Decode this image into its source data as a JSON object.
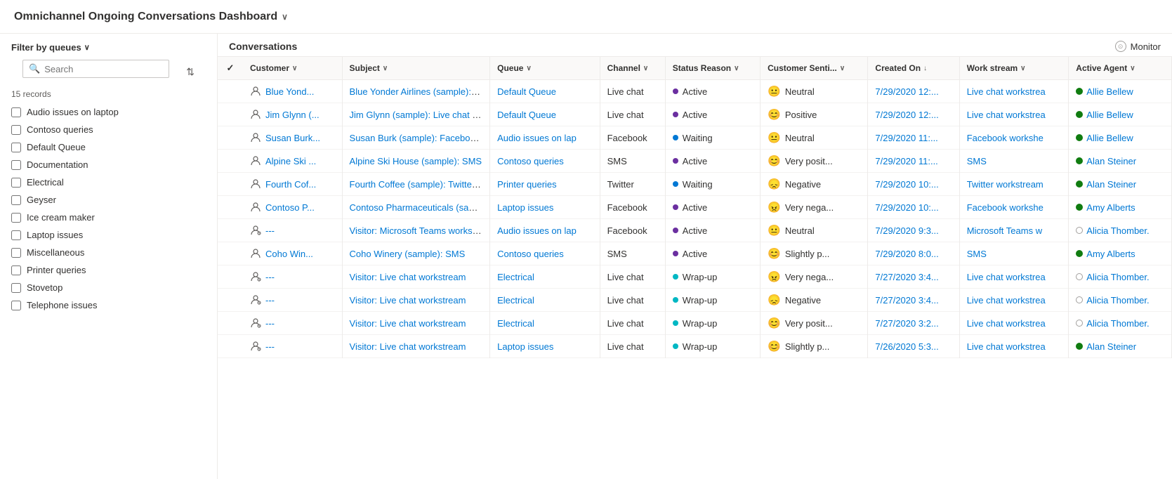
{
  "app": {
    "title": "Omnichannel Ongoing Conversations Dashboard",
    "title_chevron": "∨"
  },
  "sidebar": {
    "filter_label": "Filter by queues",
    "filter_chevron": "∨",
    "search_placeholder": "Search",
    "records_count": "15 records",
    "sort_icon": "⇅",
    "queues": [
      {
        "id": "audio-issues",
        "label": "Audio issues on laptop",
        "checked": false
      },
      {
        "id": "contoso-queries",
        "label": "Contoso queries",
        "checked": false
      },
      {
        "id": "default-queue",
        "label": "Default Queue",
        "checked": false
      },
      {
        "id": "documentation",
        "label": "Documentation",
        "checked": false
      },
      {
        "id": "electrical",
        "label": "Electrical",
        "checked": false
      },
      {
        "id": "geyser",
        "label": "Geyser",
        "checked": false
      },
      {
        "id": "ice-cream-maker",
        "label": "Ice cream maker",
        "checked": false
      },
      {
        "id": "laptop-issues",
        "label": "Laptop issues",
        "checked": false
      },
      {
        "id": "miscellaneous",
        "label": "Miscellaneous",
        "checked": false
      },
      {
        "id": "printer-queries",
        "label": "Printer queries",
        "checked": false
      },
      {
        "id": "stovetop",
        "label": "Stovetop",
        "checked": false
      },
      {
        "id": "telephone-issues",
        "label": "Telephone issues",
        "checked": false
      }
    ]
  },
  "content": {
    "title": "Conversations",
    "monitor_label": "Monitor"
  },
  "table": {
    "columns": [
      {
        "id": "check",
        "label": "✓",
        "sortable": false
      },
      {
        "id": "customer",
        "label": "Customer",
        "sortable": true
      },
      {
        "id": "subject",
        "label": "Subject",
        "sortable": true
      },
      {
        "id": "queue",
        "label": "Queue",
        "sortable": true
      },
      {
        "id": "channel",
        "label": "Channel",
        "sortable": true
      },
      {
        "id": "status_reason",
        "label": "Status Reason",
        "sortable": true
      },
      {
        "id": "customer_sentiment",
        "label": "Customer Senti...",
        "sortable": true
      },
      {
        "id": "created_on",
        "label": "Created On",
        "sortable": true,
        "active_sort": true
      },
      {
        "id": "work_stream",
        "label": "Work stream",
        "sortable": true
      },
      {
        "id": "active_agent",
        "label": "Active Agent",
        "sortable": true
      }
    ],
    "rows": [
      {
        "customer_icon": "person",
        "customer": "Blue Yond...",
        "subject": "Blue Yonder Airlines (sample): Live c",
        "queue": "Default Queue",
        "channel": "Live chat",
        "status_dot": "active",
        "status": "Active",
        "sentiment_emoji": "😐",
        "sentiment": "Neutral",
        "created_on": "7/29/2020 12:...",
        "workstream": "Live chat workstrea",
        "agent_dot": "green",
        "agent": "Allie Bellew"
      },
      {
        "customer_icon": "person",
        "customer": "Jim Glynn (...",
        "subject": "Jim Glynn (sample): Live chat works",
        "queue": "Default Queue",
        "channel": "Live chat",
        "status_dot": "active",
        "status": "Active",
        "sentiment_emoji": "😊",
        "sentiment": "Positive",
        "created_on": "7/29/2020 12:...",
        "workstream": "Live chat workstrea",
        "agent_dot": "green",
        "agent": "Allie Bellew"
      },
      {
        "customer_icon": "person",
        "customer": "Susan Burk...",
        "subject": "Susan Burk (sample): Facebook wor",
        "queue": "Audio issues on lap",
        "channel": "Facebook",
        "status_dot": "waiting",
        "status": "Waiting",
        "sentiment_emoji": "😐",
        "sentiment": "Neutral",
        "created_on": "7/29/2020 11:...",
        "workstream": "Facebook workshe",
        "agent_dot": "green",
        "agent": "Allie Bellew"
      },
      {
        "customer_icon": "person",
        "customer": "Alpine Ski ...",
        "subject": "Alpine Ski House (sample): SMS",
        "queue": "Contoso queries",
        "channel": "SMS",
        "status_dot": "active",
        "status": "Active",
        "sentiment_emoji": "😊",
        "sentiment": "Very posit...",
        "created_on": "7/29/2020 11:...",
        "workstream": "SMS",
        "agent_dot": "green",
        "agent": "Alan Steiner"
      },
      {
        "customer_icon": "person",
        "customer": "Fourth Cof...",
        "subject": "Fourth Coffee (sample): Twitter wor",
        "queue": "Printer queries",
        "channel": "Twitter",
        "status_dot": "waiting",
        "status": "Waiting",
        "sentiment_emoji": "😞",
        "sentiment": "Negative",
        "created_on": "7/29/2020 10:...",
        "workstream": "Twitter workstream",
        "agent_dot": "green",
        "agent": "Alan Steiner"
      },
      {
        "customer_icon": "person",
        "customer": "Contoso P...",
        "subject": "Contoso Pharmaceuticals (sample):",
        "queue": "Laptop issues",
        "channel": "Facebook",
        "status_dot": "active",
        "status": "Active",
        "sentiment_emoji": "😠",
        "sentiment": "Very nega...",
        "created_on": "7/29/2020 10:...",
        "workstream": "Facebook workshe",
        "agent_dot": "green",
        "agent": "Amy Alberts"
      },
      {
        "customer_icon": "visitor",
        "customer": "---",
        "subject": "Visitor: Microsoft Teams workstrea",
        "queue": "Audio issues on lap",
        "channel": "Facebook",
        "status_dot": "active",
        "status": "Active",
        "sentiment_emoji": "😐",
        "sentiment": "Neutral",
        "created_on": "7/29/2020 9:3...",
        "workstream": "Microsoft Teams w",
        "agent_dot": "empty",
        "agent": "Alicia Thomber."
      },
      {
        "customer_icon": "person",
        "customer": "Coho Win...",
        "subject": "Coho Winery (sample): SMS",
        "queue": "Contoso queries",
        "channel": "SMS",
        "status_dot": "active",
        "status": "Active",
        "sentiment_emoji": "😊",
        "sentiment": "Slightly p...",
        "created_on": "7/29/2020 8:0...",
        "workstream": "SMS",
        "agent_dot": "green",
        "agent": "Amy Alberts"
      },
      {
        "customer_icon": "visitor",
        "customer": "---",
        "subject": "Visitor: Live chat workstream",
        "queue": "Electrical",
        "channel": "Live chat",
        "status_dot": "wrap",
        "status": "Wrap-up",
        "sentiment_emoji": "😠",
        "sentiment": "Very nega...",
        "created_on": "7/27/2020 3:4...",
        "workstream": "Live chat workstrea",
        "agent_dot": "empty",
        "agent": "Alicia Thomber."
      },
      {
        "customer_icon": "visitor",
        "customer": "---",
        "subject": "Visitor: Live chat workstream",
        "queue": "Electrical",
        "channel": "Live chat",
        "status_dot": "wrap",
        "status": "Wrap-up",
        "sentiment_emoji": "😞",
        "sentiment": "Negative",
        "created_on": "7/27/2020 3:4...",
        "workstream": "Live chat workstrea",
        "agent_dot": "empty",
        "agent": "Alicia Thomber."
      },
      {
        "customer_icon": "visitor",
        "customer": "---",
        "subject": "Visitor: Live chat workstream",
        "queue": "Electrical",
        "channel": "Live chat",
        "status_dot": "wrap",
        "status": "Wrap-up",
        "sentiment_emoji": "😊",
        "sentiment": "Very posit...",
        "created_on": "7/27/2020 3:2...",
        "workstream": "Live chat workstrea",
        "agent_dot": "empty",
        "agent": "Alicia Thomber."
      },
      {
        "customer_icon": "visitor",
        "customer": "---",
        "subject": "Visitor: Live chat workstream",
        "queue": "Laptop issues",
        "channel": "Live chat",
        "status_dot": "wrap",
        "status": "Wrap-up",
        "sentiment_emoji": "😊",
        "sentiment": "Slightly p...",
        "created_on": "7/26/2020 5:3...",
        "workstream": "Live chat workstrea",
        "agent_dot": "green",
        "agent": "Alan Steiner"
      }
    ]
  }
}
